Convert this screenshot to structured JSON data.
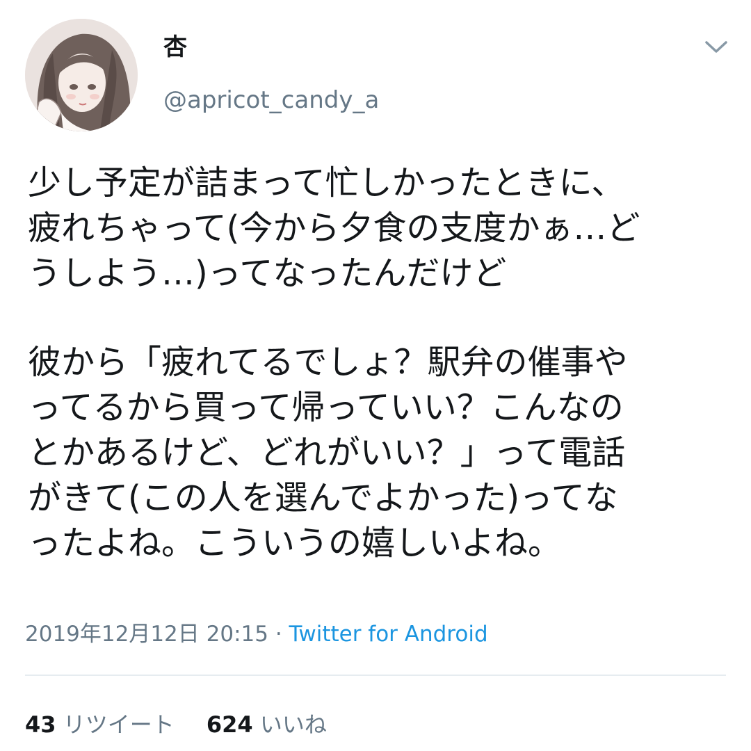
{
  "user": {
    "display_name": "杏",
    "handle": "@apricot_candy_a",
    "avatar": "illustrated-girl-avatar"
  },
  "tweet": {
    "lines": [
      "少し予定が詰まって忙しかったときに、",
      "疲れちゃって(今から夕食の支度かぁ…ど",
      "うしよう…)ってなったんだけど",
      "",
      "彼から「疲れてるでしょ？駅弁の催事や",
      "ってるから買って帰っていい？こんなの",
      "とかあるけど、どれがいい？」って電話",
      "がきて(この人を選んでよかった)ってな",
      "ったよね。こういうの嬉しいよね。"
    ]
  },
  "meta": {
    "timestamp": "2019年12月12日 20:15",
    "separator": " · ",
    "source": "Twitter for Android"
  },
  "stats": {
    "retweets_count": "43",
    "retweets_label": "リツイート",
    "likes_count": "624",
    "likes_label": "いいね"
  },
  "icons": {
    "menu": "chevron-down-icon"
  },
  "colors": {
    "text_primary": "#14171a",
    "text_secondary": "#657786",
    "link": "#1b95e0",
    "divider": "#e6ecf0"
  }
}
